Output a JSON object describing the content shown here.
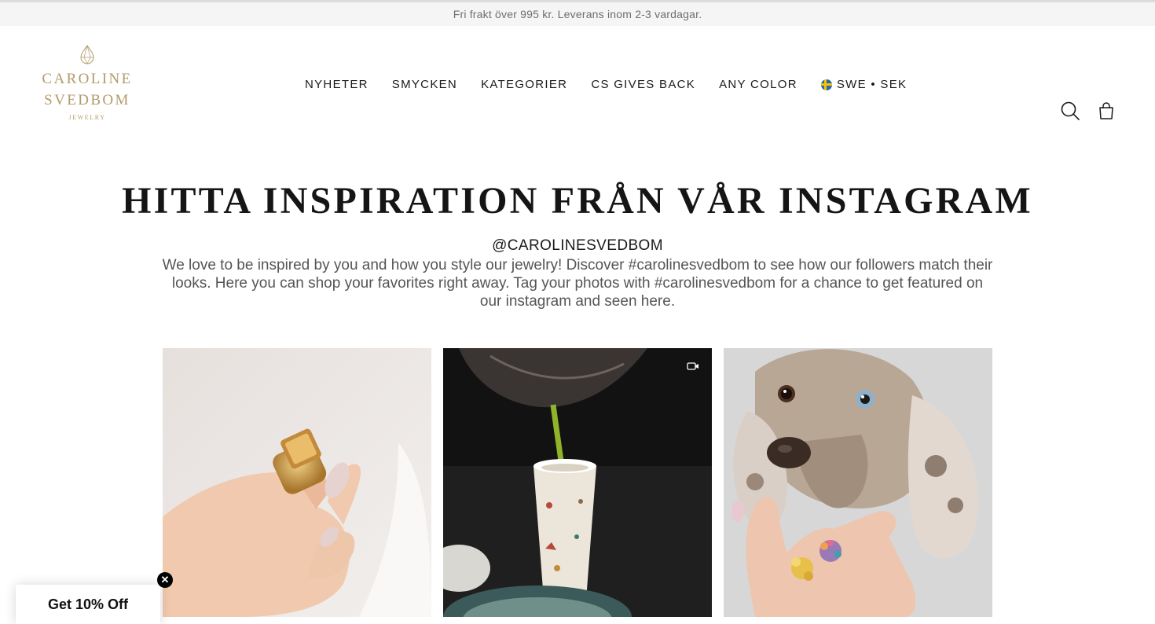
{
  "announcement": "Fri frakt över 995 kr. Leverans inom 2-3 vardagar.",
  "logo": {
    "line1": "CAROLINE",
    "line2": "SVEDBOM",
    "line3": "JEWELRY"
  },
  "nav": {
    "items": [
      {
        "label": "NYHETER"
      },
      {
        "label": "SMYCKEN"
      },
      {
        "label": "KATEGORIER"
      },
      {
        "label": "CS GIVES BACK"
      },
      {
        "label": "ANY COLOR"
      }
    ],
    "locale": "SWE • SEK"
  },
  "icons": {
    "search": "search-icon",
    "cart": "shopping-bag-icon",
    "flag": "sweden-flag-icon",
    "video": "video-camera-icon",
    "close": "close-icon"
  },
  "headline": "HITTA INSPIRATION FRÅN VÅR INSTAGRAM",
  "handle": "@CAROLINESVEDBOM",
  "description": "We love to be inspired by you and how you style our jewelry! Discover #carolinesvedbom to see how our followers match their looks. Here you can shop your favorites right away. Tag your photos with #carolinesvedbom for a chance to get featured on our instagram and seen here.",
  "promo": {
    "label": "Get 10% Off",
    "close": "✕"
  },
  "colors": {
    "brand_gold": "#b39a6a",
    "text": "#1a1a1a",
    "announce_bg": "#f5f5f5"
  }
}
